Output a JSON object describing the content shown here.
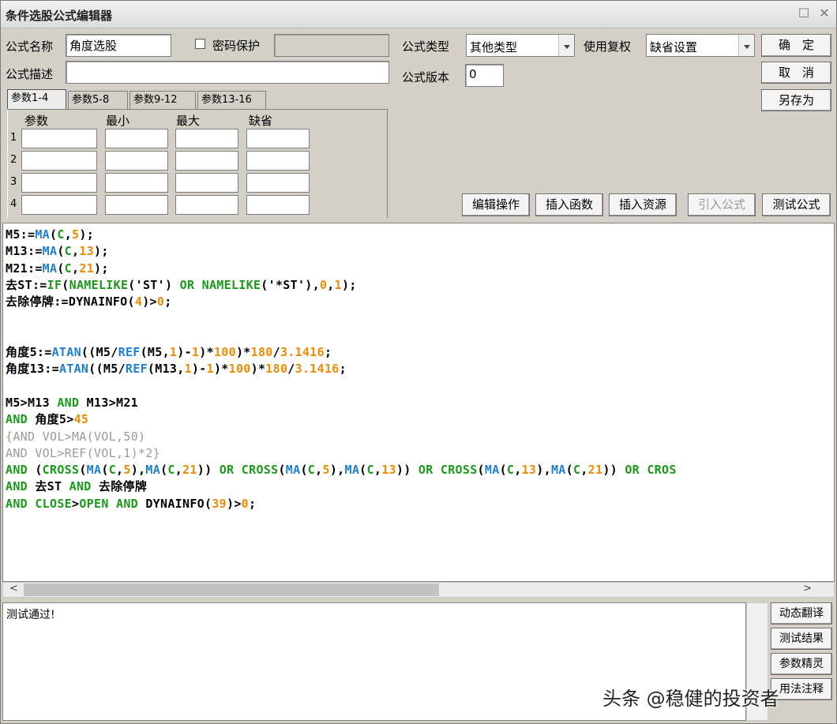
{
  "window": {
    "title": "条件选股公式编辑器"
  },
  "form": {
    "name_label": "公式名称",
    "name_value": "角度选股",
    "password_label": "密码保护",
    "desc_label": "公式描述",
    "desc_value": "",
    "type_label": "公式类型",
    "type_value": "其他类型",
    "version_label": "公式版本",
    "version_value": "0",
    "rights_label": "使用复权",
    "rights_value": "缺省设置"
  },
  "buttons": {
    "ok": "确　定",
    "cancel": "取　消",
    "save_as": "另存为",
    "edit_ops": "编辑操作",
    "insert_func": "插入函数",
    "insert_res": "插入资源",
    "import_formula": "引入公式",
    "test_formula": "测试公式"
  },
  "tabs": [
    {
      "label": "参数1-4",
      "active": true
    },
    {
      "label": "参数5-8"
    },
    {
      "label": "参数9-12"
    },
    {
      "label": "参数13-16"
    }
  ],
  "params": {
    "headers": [
      "参数",
      "最小",
      "最大",
      "缺省"
    ],
    "rows": [
      "1",
      "2",
      "3",
      "4"
    ]
  },
  "code_lines": [
    [
      [
        "k",
        "M5:="
      ],
      [
        "f",
        "MA"
      ],
      [
        "k",
        "("
      ],
      [
        "g",
        "C"
      ],
      [
        "k",
        ","
      ],
      [
        "n",
        "5"
      ],
      [
        "k",
        ");"
      ]
    ],
    [
      [
        "k",
        "M13:="
      ],
      [
        "f",
        "MA"
      ],
      [
        "k",
        "("
      ],
      [
        "g",
        "C"
      ],
      [
        "k",
        ","
      ],
      [
        "n",
        "13"
      ],
      [
        "k",
        ");"
      ]
    ],
    [
      [
        "k",
        "M21:="
      ],
      [
        "f",
        "MA"
      ],
      [
        "k",
        "("
      ],
      [
        "g",
        "C"
      ],
      [
        "k",
        ","
      ],
      [
        "n",
        "21"
      ],
      [
        "k",
        ");"
      ]
    ],
    [
      [
        "k",
        "去ST:="
      ],
      [
        "g",
        "IF"
      ],
      [
        "k",
        "("
      ],
      [
        "g",
        "NAMELIKE"
      ],
      [
        "k",
        "('ST') "
      ],
      [
        "g",
        "OR"
      ],
      [
        "k",
        " "
      ],
      [
        "g",
        "NAMELIKE"
      ],
      [
        "k",
        "('*ST'),"
      ],
      [
        "n",
        "0"
      ],
      [
        "k",
        ","
      ],
      [
        "n",
        "1"
      ],
      [
        "k",
        ");"
      ]
    ],
    [
      [
        "k",
        "去除停牌:=DYNAINFO("
      ],
      [
        "n",
        "4"
      ],
      [
        "k",
        ")>"
      ],
      [
        "n",
        "0"
      ],
      [
        "k",
        ";"
      ]
    ],
    [],
    [],
    [
      [
        "k",
        "角度5:="
      ],
      [
        "f",
        "ATAN"
      ],
      [
        "k",
        "((M5/"
      ],
      [
        "f",
        "REF"
      ],
      [
        "k",
        "(M5,"
      ],
      [
        "n",
        "1"
      ],
      [
        "k",
        ")-"
      ],
      [
        "n",
        "1"
      ],
      [
        "k",
        ")*"
      ],
      [
        "n",
        "100"
      ],
      [
        "k",
        ")*"
      ],
      [
        "n",
        "180"
      ],
      [
        "k",
        "/"
      ],
      [
        "n",
        "3.1416"
      ],
      [
        "k",
        ";"
      ]
    ],
    [
      [
        "k",
        "角度13:="
      ],
      [
        "f",
        "ATAN"
      ],
      [
        "k",
        "((M5/"
      ],
      [
        "f",
        "REF"
      ],
      [
        "k",
        "(M13,"
      ],
      [
        "n",
        "1"
      ],
      [
        "k",
        ")-"
      ],
      [
        "n",
        "1"
      ],
      [
        "k",
        ")*"
      ],
      [
        "n",
        "100"
      ],
      [
        "k",
        ")*"
      ],
      [
        "n",
        "180"
      ],
      [
        "k",
        "/"
      ],
      [
        "n",
        "3.1416"
      ],
      [
        "k",
        ";"
      ]
    ],
    [],
    [
      [
        "k",
        "M5>M13 "
      ],
      [
        "g",
        "AND"
      ],
      [
        "k",
        " M13>M21"
      ]
    ],
    [
      [
        "g",
        "AND"
      ],
      [
        "k",
        " 角度5>"
      ],
      [
        "n",
        "45"
      ]
    ],
    [
      [
        "c",
        "{AND VOL>MA(VOL,50)"
      ]
    ],
    [
      [
        "c",
        "AND VOL>REF(VOL,1)*2}"
      ]
    ],
    [
      [
        "g",
        "AND"
      ],
      [
        "k",
        " ("
      ],
      [
        "g",
        "CROSS"
      ],
      [
        "k",
        "("
      ],
      [
        "f",
        "MA"
      ],
      [
        "k",
        "("
      ],
      [
        "g",
        "C"
      ],
      [
        "k",
        ","
      ],
      [
        "n",
        "5"
      ],
      [
        "k",
        "),"
      ],
      [
        "f",
        "MA"
      ],
      [
        "k",
        "("
      ],
      [
        "g",
        "C"
      ],
      [
        "k",
        ","
      ],
      [
        "n",
        "21"
      ],
      [
        "k",
        ")) "
      ],
      [
        "g",
        "OR"
      ],
      [
        "k",
        " "
      ],
      [
        "g",
        "CROSS"
      ],
      [
        "k",
        "("
      ],
      [
        "f",
        "MA"
      ],
      [
        "k",
        "("
      ],
      [
        "g",
        "C"
      ],
      [
        "k",
        ","
      ],
      [
        "n",
        "5"
      ],
      [
        "k",
        "),"
      ],
      [
        "f",
        "MA"
      ],
      [
        "k",
        "("
      ],
      [
        "g",
        "C"
      ],
      [
        "k",
        ","
      ],
      [
        "n",
        "13"
      ],
      [
        "k",
        ")) "
      ],
      [
        "g",
        "OR"
      ],
      [
        "k",
        " "
      ],
      [
        "g",
        "CROSS"
      ],
      [
        "k",
        "("
      ],
      [
        "f",
        "MA"
      ],
      [
        "k",
        "("
      ],
      [
        "g",
        "C"
      ],
      [
        "k",
        ","
      ],
      [
        "n",
        "13"
      ],
      [
        "k",
        "),"
      ],
      [
        "f",
        "MA"
      ],
      [
        "k",
        "("
      ],
      [
        "g",
        "C"
      ],
      [
        "k",
        ","
      ],
      [
        "n",
        "21"
      ],
      [
        "k",
        ")) "
      ],
      [
        "g",
        "OR"
      ],
      [
        "k",
        " "
      ],
      [
        "g",
        "CROS"
      ]
    ],
    [
      [
        "g",
        "AND"
      ],
      [
        "k",
        " 去ST "
      ],
      [
        "g",
        "AND"
      ],
      [
        "k",
        " 去除停牌"
      ]
    ],
    [
      [
        "g",
        "AND"
      ],
      [
        "k",
        " "
      ],
      [
        "g",
        "CLOSE"
      ],
      [
        "k",
        ">"
      ],
      [
        "g",
        "OPEN"
      ],
      [
        "k",
        " "
      ],
      [
        "g",
        "AND"
      ],
      [
        "k",
        " DYNAINFO("
      ],
      [
        "n",
        "39"
      ],
      [
        "k",
        ")>"
      ],
      [
        "n",
        "0"
      ],
      [
        "k",
        ";"
      ]
    ]
  ],
  "output": {
    "text": "测试通过!"
  },
  "side_buttons": [
    "动态翻译",
    "测试结果",
    "参数精灵",
    "用法注释"
  ],
  "watermark": "头条 @稳健的投资者"
}
